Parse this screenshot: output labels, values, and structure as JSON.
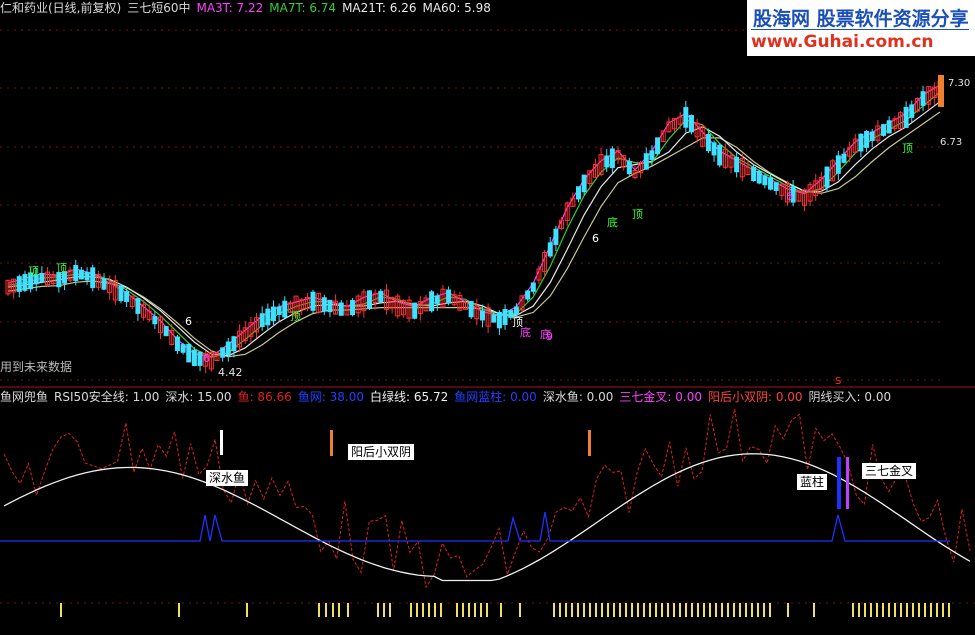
{
  "header": {
    "items": [
      {
        "text": "仁和药业(日线,前复权)",
        "color": "#d8d8d8"
      },
      {
        "text": "三七短60中",
        "color": "#d8d8d8"
      },
      {
        "text": "MA3T: 7.22",
        "color": "#ff40ff"
      },
      {
        "text": "MA7T: 6.74",
        "color": "#30d030"
      },
      {
        "text": "MA21T: 6.26",
        "color": "#e8e8e8"
      },
      {
        "text": "MA60: 5.98",
        "color": "#e8e8e8"
      }
    ]
  },
  "watermark": {
    "line1": "股海网 股票软件资源分享",
    "line2": "www.Guhai.com.cn"
  },
  "note": "用到未来数据",
  "indicator_header": {
    "items": [
      {
        "text": "鱼网兜鱼",
        "color": "#d8d8d8"
      },
      {
        "text": "RSI50安全线: 1.00",
        "color": "#d8d8d8"
      },
      {
        "text": "深水: 15.00",
        "color": "#d8d8d8"
      },
      {
        "text": "鱼: 86.66",
        "color": "#e02020"
      },
      {
        "text": "鱼网: 38.00",
        "color": "#2040ff"
      },
      {
        "text": "白绿线: 65.72",
        "color": "#f0f0f0"
      },
      {
        "text": "鱼网蓝柱: 0.00",
        "color": "#2040ff"
      },
      {
        "text": "深水鱼: 0.00",
        "color": "#d8d8d8"
      },
      {
        "text": "三七金叉: 0.00",
        "color": "#ff40ff"
      },
      {
        "text": "阳后小双阴: 0.00",
        "color": "#ff4040"
      },
      {
        "text": "阴线买入: 0.00",
        "color": "#d8d8d8"
      }
    ]
  },
  "labels": {
    "deep_fish": "深水鱼",
    "yang_after": "阳后小双阴",
    "blue_col": "蓝柱",
    "golden_cross": "三七金叉",
    "low_price": "4.42",
    "price_top": "7.30",
    "price_mid": "6.73",
    "marker_s": "S"
  },
  "chart_data": [
    {
      "type": "candlestick",
      "title": "仁和药业(日线,前复权)",
      "series": [
        {
          "name": "MA3T",
          "last": 7.22,
          "color": "#ff40ff"
        },
        {
          "name": "MA7T",
          "last": 6.74,
          "color": "#30d030"
        },
        {
          "name": "MA21T",
          "last": 6.26,
          "color": "#e8e8e8"
        },
        {
          "name": "MA60",
          "last": 5.98,
          "color": "#e8e8e8"
        }
      ],
      "close_path": [
        5.2,
        5.25,
        5.3,
        5.28,
        5.35,
        5.3,
        5.2,
        5.1,
        4.95,
        4.8,
        4.6,
        4.45,
        4.42,
        4.55,
        4.7,
        4.85,
        4.95,
        5.0,
        5.05,
        5.0,
        4.95,
        5.05,
        5.1,
        5.0,
        4.95,
        5.05,
        5.1,
        5.0,
        4.9,
        4.85,
        4.95,
        5.2,
        5.6,
        6.0,
        6.3,
        6.5,
        6.6,
        6.4,
        6.6,
        6.9,
        7.0,
        6.8,
        6.6,
        6.5,
        6.4,
        6.3,
        6.2,
        6.15,
        6.3,
        6.5,
        6.7,
        6.8,
        6.9,
        7.0,
        7.2,
        7.3
      ],
      "annotations": {
        "low": 4.42,
        "right_labels": [
          7.3,
          6.73
        ]
      },
      "marks": [
        "顶",
        "顶",
        "6",
        "6",
        "顶",
        "底",
        "6",
        "底",
        "顶",
        "6",
        "顶",
        "底",
        "顶",
        "9"
      ]
    },
    {
      "type": "line",
      "title": "鱼网兜鱼",
      "series": [
        {
          "name": "鱼",
          "last": 86.66,
          "color": "#e02020",
          "style": "dashed"
        },
        {
          "name": "鱼网",
          "last": 38.0,
          "color": "#2040ff"
        },
        {
          "name": "白绿线",
          "last": 65.72,
          "color": "#f0f0f0"
        }
      ],
      "values": {
        "RSI50安全线": 1.0,
        "深水": 15.0,
        "鱼网蓝柱": 0.0,
        "深水鱼": 0.0,
        "三七金叉": 0.0,
        "阳后小双阴": 0.0,
        "阴线买入": 0.0
      }
    }
  ]
}
